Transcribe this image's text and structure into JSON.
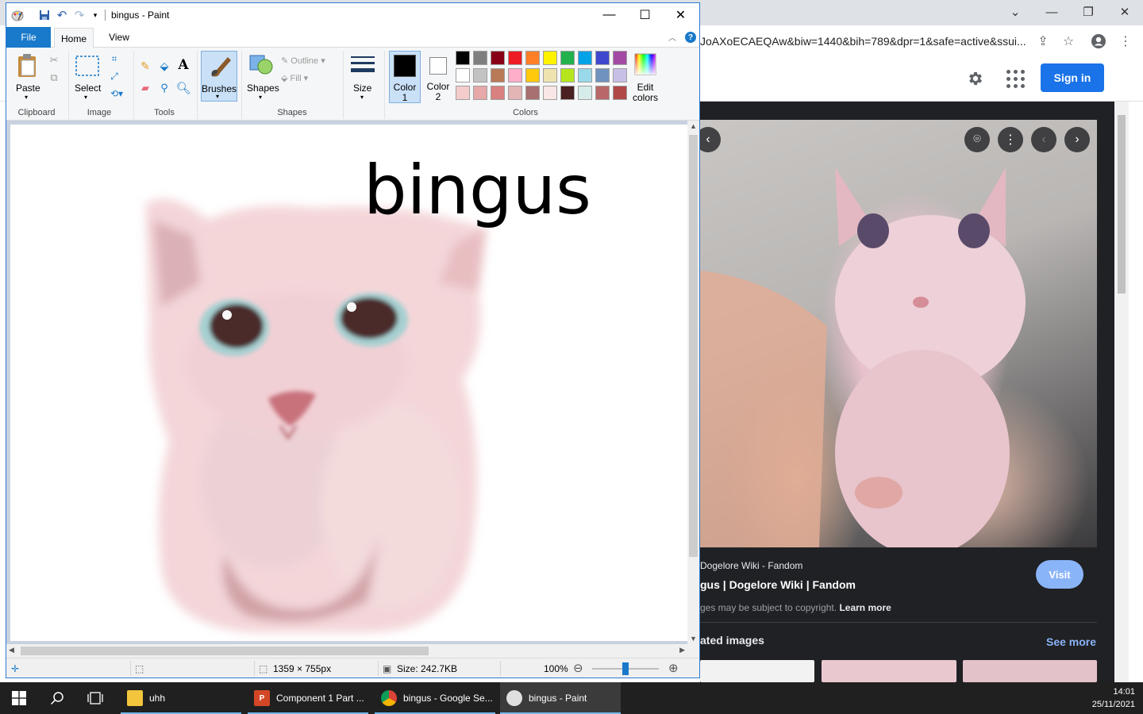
{
  "chrome": {
    "url": "JoAXoECAEQAw&biw=1440&bih=789&dpr=1&safe=active&ssui...",
    "sign_in_label": "Sign in",
    "viewer": {
      "source_name": "Dogelore Wiki - Fandom",
      "result_title": "gus | Dogelore Wiki | Fandom",
      "copyright_text": "ges may be subject to copyright.",
      "learn_more": "Learn more",
      "visit_label": "Visit",
      "related_heading": "ated images",
      "see_more": "See more"
    }
  },
  "paint": {
    "window_title": "bingus - Paint",
    "tabs": {
      "file": "File",
      "home": "Home",
      "view": "View"
    },
    "groups": {
      "clipboard": "Clipboard",
      "image": "Image",
      "tools": "Tools",
      "shapes": "Shapes",
      "colors": "Colors"
    },
    "buttons": {
      "paste": "Paste",
      "select": "Select",
      "brushes": "Brushes",
      "shapes": "Shapes",
      "outline": "Outline",
      "fill": "Fill",
      "size": "Size",
      "color1_line1": "Color",
      "color1_line2": "1",
      "color2_line1": "Color",
      "color2_line2": "2",
      "edit_colors_line1": "Edit",
      "edit_colors_line2": "colors"
    },
    "palette": [
      [
        "#000000",
        "#7f7f7f",
        "#880015",
        "#ed1c24",
        "#ff7f27",
        "#fff200",
        "#22b14c",
        "#00a2e8",
        "#3f48cc",
        "#a349a4"
      ],
      [
        "#ffffff",
        "#c3c3c3",
        "#b97a57",
        "#ffaec9",
        "#ffc90e",
        "#efe4b0",
        "#b5e61d",
        "#99d9ea",
        "#7092be",
        "#c8bfe7"
      ],
      [
        "#f4cccc",
        "#e6a8a8",
        "#d98080",
        "#e3b5b5",
        "#a87070",
        "#f9e6e6",
        "#4a2020",
        "#d6eceb",
        "#b86868",
        "#b04848"
      ]
    ],
    "color1": "#000000",
    "color2": "#ffffff",
    "canvas_text": "bingus",
    "status": {
      "dimensions": "1359 × 755px",
      "size": "Size: 242.7KB",
      "zoom": "100%"
    }
  },
  "taskbar": {
    "apps": [
      {
        "label": "uhh",
        "icon": "folder-icon"
      },
      {
        "label": "Component 1 Part ...",
        "icon": "powerpoint-icon"
      },
      {
        "label": "bingus - Google Se...",
        "icon": "chrome-icon"
      },
      {
        "label": "bingus - Paint",
        "icon": "paint-icon"
      }
    ],
    "time": "14:01",
    "date": "25/11/2021"
  }
}
